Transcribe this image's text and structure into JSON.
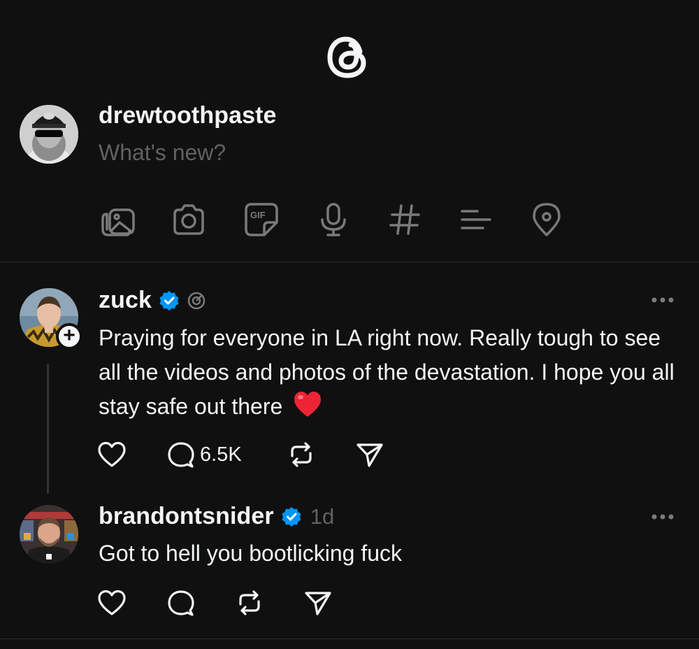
{
  "header": {
    "logo_icon": "threads-logo-icon"
  },
  "composer": {
    "username": "drewtoothpaste",
    "placeholder": "What's new?",
    "tools": [
      "image-gallery-icon",
      "camera-icon",
      "gif-icon",
      "microphone-icon",
      "hashtag-icon",
      "poll-icon",
      "location-pin-icon"
    ],
    "gif_label": "GIF"
  },
  "posts": [
    {
      "username": "zuck",
      "verified": true,
      "badge_icon": "threads-activity-icon",
      "text": "Praying for everyone in LA right now. Really tough to see all the videos and photos of the devastation. I hope you all stay safe out there",
      "emoji": "❤️",
      "follow_label": "+",
      "actions": {
        "like": "",
        "reply": "6.5K",
        "repost": "",
        "share": ""
      }
    },
    {
      "username": "brandontsnider",
      "verified": true,
      "time": "1d",
      "text": "Got to hell you bootlicking fuck",
      "actions": {
        "like": "",
        "reply": "",
        "repost": "",
        "share": ""
      }
    }
  ],
  "colors": {
    "background": "#101010",
    "text": "#f3f5f7",
    "muted": "#616161",
    "verified": "#0095f6",
    "divider": "#2e2e2e"
  }
}
